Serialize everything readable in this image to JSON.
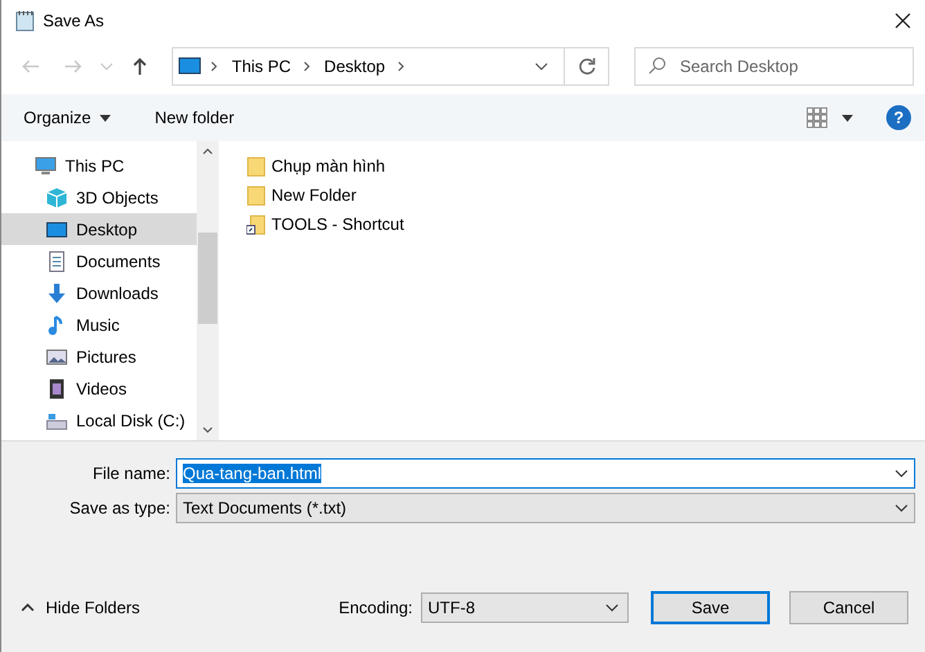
{
  "window": {
    "title": "Save As"
  },
  "navigation": [
    {
      "disabled": true
    },
    {
      "disabled": true
    },
    {
      "disabled": true
    },
    {
      "disabled": false
    }
  ],
  "breadcrumb": [
    "This PC",
    "Desktop"
  ],
  "search": {
    "placeholder": "Search Desktop"
  },
  "toolbar": {
    "organize": "Organize",
    "new_folder": "New folder",
    "help": "?"
  },
  "sidebar": {
    "items": [
      {
        "label": "This PC",
        "selected": false,
        "children": [
          {
            "label": "3D Objects",
            "selected": false
          },
          {
            "label": "Desktop",
            "selected": true
          },
          {
            "label": "Documents",
            "selected": false
          },
          {
            "label": "Downloads",
            "selected": false
          },
          {
            "label": "Music",
            "selected": false
          },
          {
            "label": "Pictures",
            "selected": false
          },
          {
            "label": "Videos",
            "selected": false
          },
          {
            "label": "Local Disk (C:)",
            "selected": false
          }
        ]
      }
    ]
  },
  "files": [
    {
      "name": "Chụp màn hình",
      "kind": "folder"
    },
    {
      "name": "New Folder",
      "kind": "folder"
    },
    {
      "name": "TOOLS - Shortcut",
      "kind": "shortcut"
    }
  ],
  "file_name": {
    "label": "File name:",
    "value": "Qua-tang-ban.html",
    "highlighted": true
  },
  "save_as_type": {
    "label": "Save as type:",
    "value": "Text Documents (*.txt)"
  },
  "hide_folders": "Hide Folders",
  "encoding": {
    "label": "Encoding:",
    "value": "UTF-8"
  },
  "buttons": [
    {
      "label": "Save",
      "default": true
    },
    {
      "label": "Cancel",
      "default": false
    }
  ]
}
